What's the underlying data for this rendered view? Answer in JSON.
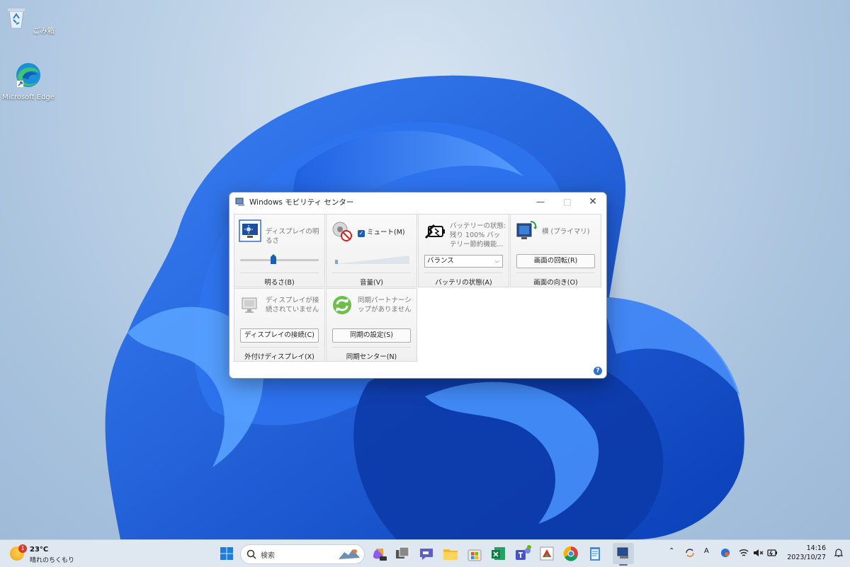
{
  "desktop": {
    "icons": [
      {
        "label": "ごみ箱"
      },
      {
        "label": "Microsoft Edge"
      }
    ]
  },
  "window": {
    "title": "Windows モビリティ センター",
    "controls": {
      "minimize": "—",
      "maximize": "□",
      "close": "✕"
    },
    "tiles": {
      "brightness": {
        "text": "ディスプレイの明るさ",
        "caption": "明るさ(B)",
        "level_percent": 42
      },
      "volume": {
        "mute_label": "ミュート(M)",
        "mute_checked": true,
        "caption": "音量(V)"
      },
      "battery": {
        "text": "バッテリーの状態: 残り 100% バッテリー節約機能...",
        "select_value": "バランス",
        "caption": "バッテリの状態(A)"
      },
      "orientation": {
        "text": "横 (プライマリ)",
        "button": "画面の回転(R)",
        "caption": "画面の向き(O)"
      },
      "external_display": {
        "text": "ディスプレイが接続されていません",
        "button": "ディスプレイの接続(C)",
        "caption": "外付けディスプレイ(X)"
      },
      "sync": {
        "text": "同期パートナーシップがありません",
        "button": "同期の設定(S)",
        "caption": "同期センター(N)"
      }
    },
    "help": "?"
  },
  "taskbar": {
    "weather": {
      "temp": "23°C",
      "desc": "晴れのちくもり",
      "badge": "1"
    },
    "search_placeholder": "検索",
    "tray": {
      "ime": "A"
    },
    "clock": {
      "time": "14:16",
      "date": "2023/10/27"
    }
  },
  "colors": {
    "accent": "#1a5fb4",
    "taskbar": "#dfe7f0"
  }
}
